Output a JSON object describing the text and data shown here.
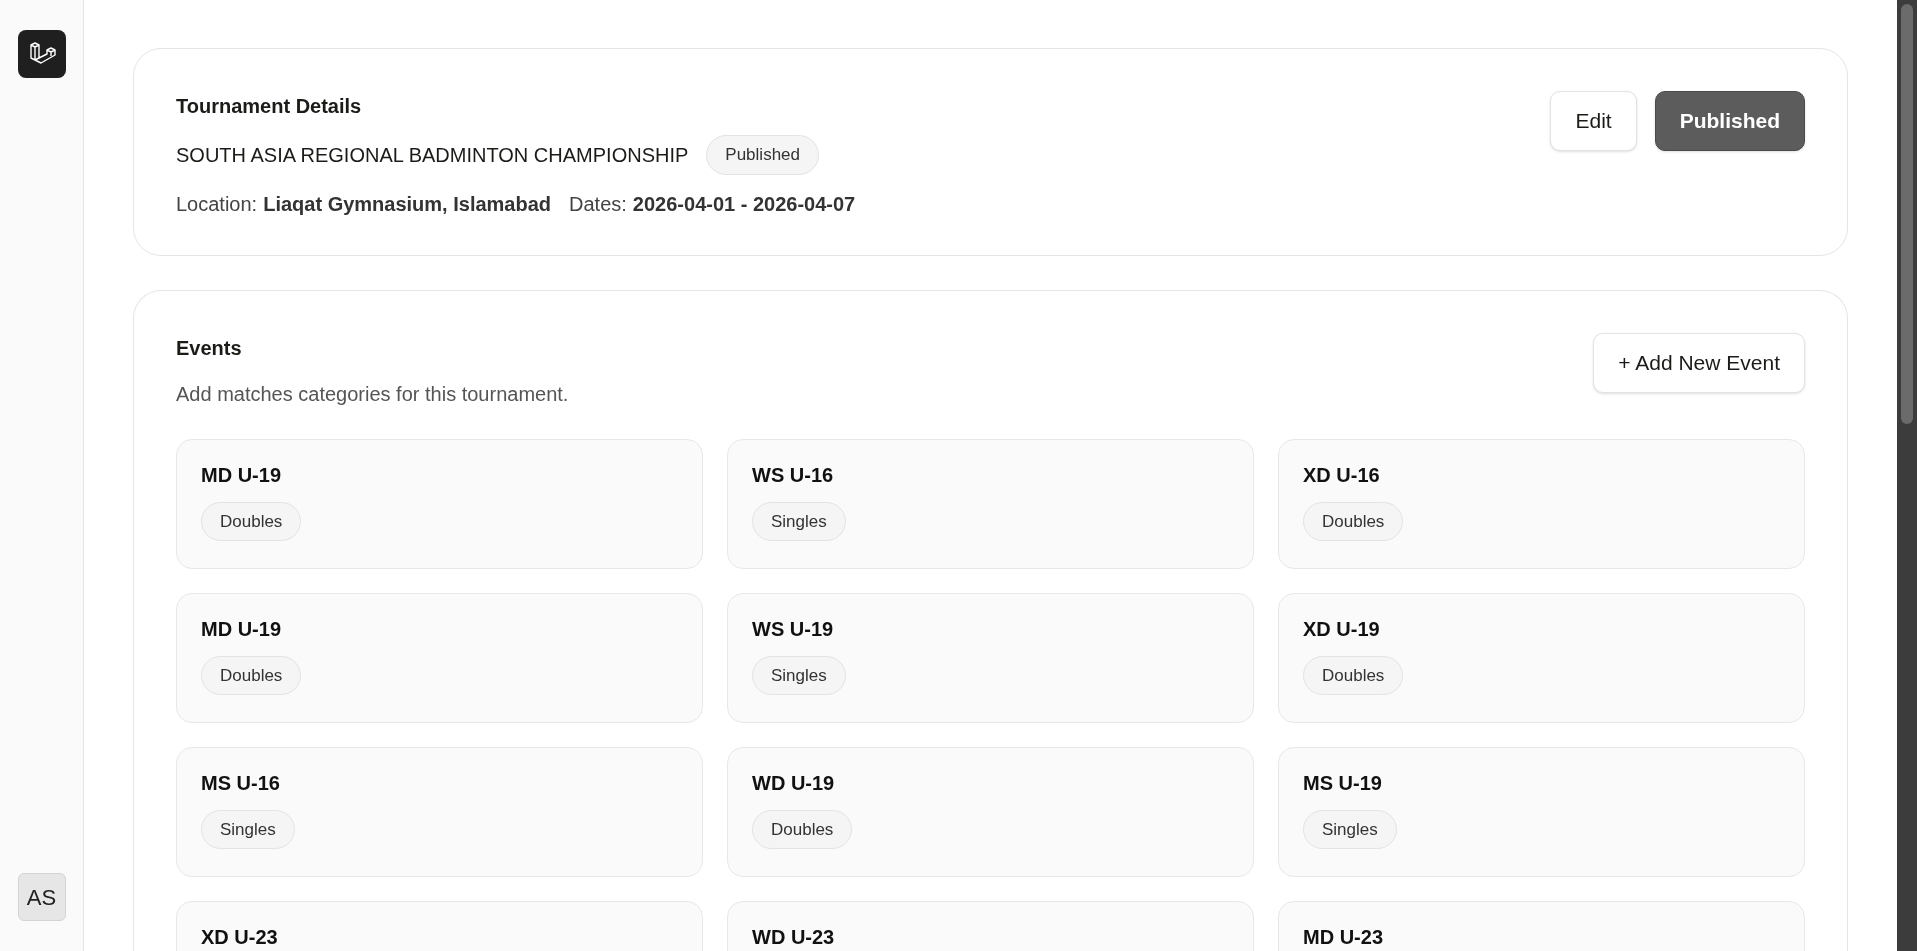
{
  "sidebar": {
    "user_initials": "AS"
  },
  "tournament": {
    "heading": "Tournament Details",
    "name": "SOUTH ASIA REGIONAL BADMINTON CHAMPIONSHIP",
    "status": "Published",
    "location_label": "Location:",
    "location": "Liaqat Gymnasium, Islamabad",
    "dates_label": "Dates:",
    "dates": "2026-04-01 - 2026-04-07",
    "buttons": [
      {
        "label": "Edit",
        "kind": "outline"
      },
      {
        "label": "Published",
        "kind": "filled"
      }
    ]
  },
  "events": {
    "heading": "Events",
    "subtitle": "Add matches categories for this tournament.",
    "add_button": "+ Add New Event",
    "items": [
      {
        "name": "MD U-19",
        "type": "Doubles"
      },
      {
        "name": "WS U-16",
        "type": "Singles"
      },
      {
        "name": "XD U-16",
        "type": "Doubles"
      },
      {
        "name": "MD U-19",
        "type": "Doubles"
      },
      {
        "name": "WS U-19",
        "type": "Singles"
      },
      {
        "name": "XD U-19",
        "type": "Doubles"
      },
      {
        "name": "MS U-16",
        "type": "Singles"
      },
      {
        "name": "WD U-19",
        "type": "Doubles"
      },
      {
        "name": "MS U-19",
        "type": "Singles"
      },
      {
        "name": "XD U-23"
      },
      {
        "name": "WD U-23"
      },
      {
        "name": "MD U-23"
      }
    ]
  }
}
